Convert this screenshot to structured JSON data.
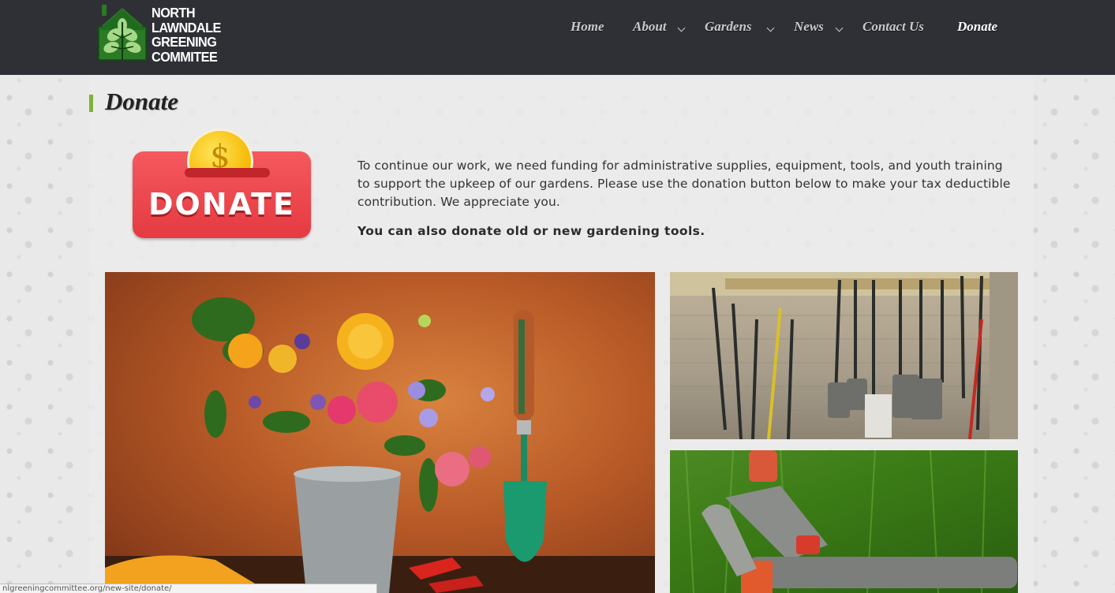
{
  "brand": {
    "logo_lines": [
      "NORTH",
      "LAWNDALE",
      "GREENING",
      "COMMITEE"
    ],
    "logo_icon": "house-tree-icon"
  },
  "nav": {
    "items": [
      {
        "label": "Home",
        "has_dropdown": false,
        "active": false
      },
      {
        "label": "About",
        "has_dropdown": true,
        "active": false
      },
      {
        "label": "Gardens",
        "has_dropdown": true,
        "active": false
      },
      {
        "label": "News",
        "has_dropdown": true,
        "active": false
      },
      {
        "label": "Contact Us",
        "has_dropdown": false,
        "active": false
      },
      {
        "label": "Donate",
        "has_dropdown": false,
        "active": true
      }
    ]
  },
  "page": {
    "title": "Donate",
    "donate_graphic": {
      "text": "DONATE",
      "coin_symbol": "$"
    },
    "intro": "To continue our work, we need funding for administrative supplies, equipment, tools, and youth training to support the upkeep of our gardens. Please use the donation button below to make your tax deductible contribution. We appreciate you.",
    "tools_note": "You can also donate old or new gardening tools.",
    "photos": [
      "flowers-trowel-photo",
      "tool-shed-photo",
      "hose-nozzle-photo"
    ]
  },
  "status_bar": {
    "url": "nlgreeningcommittee.org/new-site/donate/"
  },
  "colors": {
    "header_bg": "#2f3035",
    "accent_green": "#7db23a",
    "donate_red": "#e53a41"
  }
}
